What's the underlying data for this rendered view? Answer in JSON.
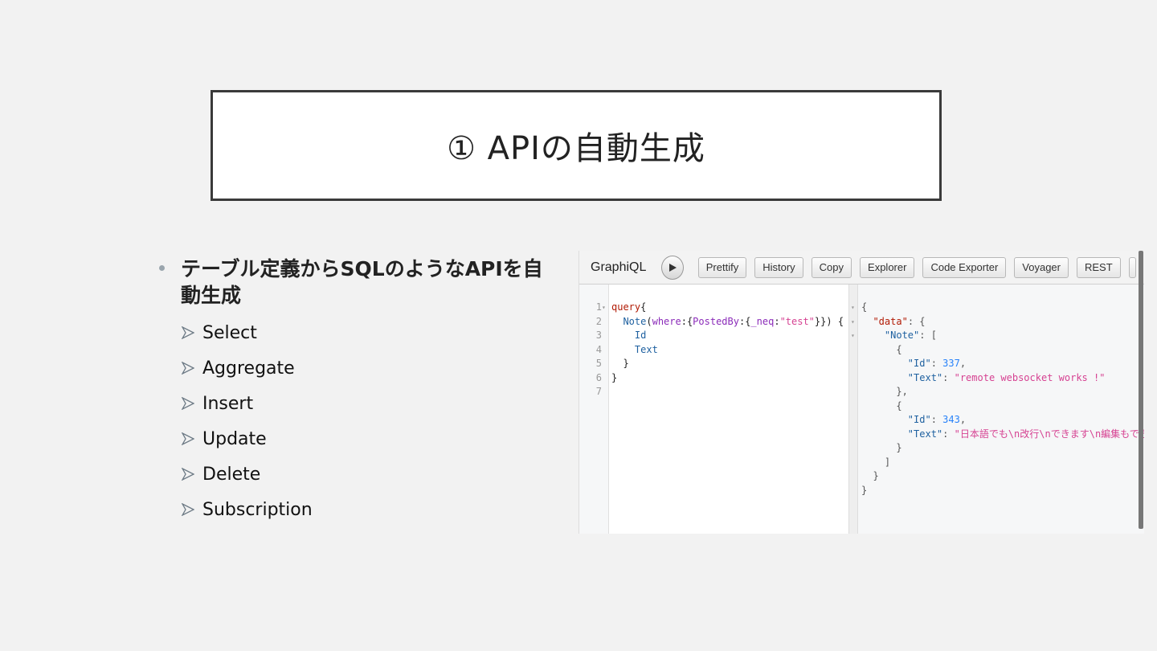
{
  "slide": {
    "title": "① APIの自動生成",
    "bullet_main": "テーブル定義からSQLのようなAPIを自動生成",
    "sub_items": [
      "Select",
      "Aggregate",
      "Insert",
      "Update",
      "Delete",
      "Subscription"
    ]
  },
  "graphiql": {
    "logo": "GraphiQL",
    "toolbar_buttons": {
      "prettify": "Prettify",
      "history": "History",
      "copy": "Copy",
      "explorer": "Explorer",
      "code_exporter": "Code Exporter",
      "voyager": "Voyager",
      "rest": "REST"
    },
    "query_line_numbers": [
      "1",
      "2",
      "3",
      "4",
      "5",
      "6",
      "7"
    ],
    "query": {
      "keyword": "query",
      "type": "Note",
      "arg_where": "where",
      "arg_postedby": "PostedBy",
      "arg_neq": "_neq",
      "arg_value": "\"test\"",
      "field_id": "Id",
      "field_text": "Text"
    },
    "result": {
      "data_key": "\"data\"",
      "note_key": "\"Note\"",
      "id_key": "\"Id\"",
      "text_key": "\"Text\"",
      "rows": [
        {
          "id": "337",
          "text": "\"remote websocket works !\""
        },
        {
          "id": "343",
          "text": "\"日本語でも\\n改行\\nできます\\n編集もでき"
        }
      ]
    }
  },
  "colors": {
    "keyword": "#b11a04",
    "def": "#1f61a0",
    "attribute": "#8b2bb9",
    "string": "#d64292",
    "number": "#2882f9"
  },
  "icons": [
    "play-icon",
    "chevron-right-arrow-icon",
    "fold-arrow-icon"
  ]
}
